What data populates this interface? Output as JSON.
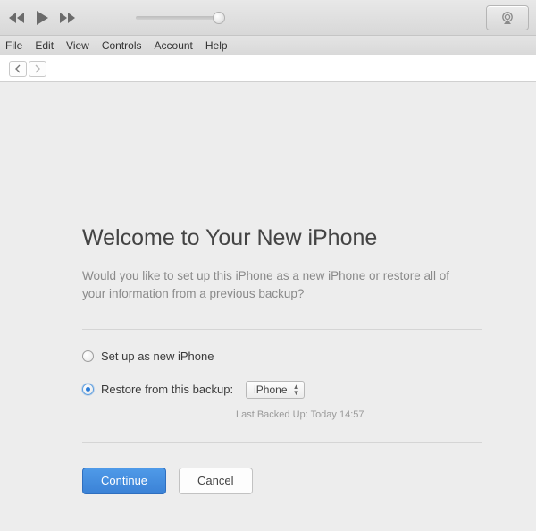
{
  "menu": {
    "items": [
      "File",
      "Edit",
      "View",
      "Controls",
      "Account",
      "Help"
    ]
  },
  "main": {
    "title": "Welcome to Your New iPhone",
    "subtitle": "Would you like to set up this iPhone as a new iPhone or restore all of your information from a previous backup?",
    "option_new": "Set up as new iPhone",
    "option_restore": "Restore from this backup:",
    "selected_option": "restore",
    "backup_select": {
      "value": "iPhone"
    },
    "last_backup": "Last Backed Up: Today 14:57",
    "continue_label": "Continue",
    "cancel_label": "Cancel"
  }
}
